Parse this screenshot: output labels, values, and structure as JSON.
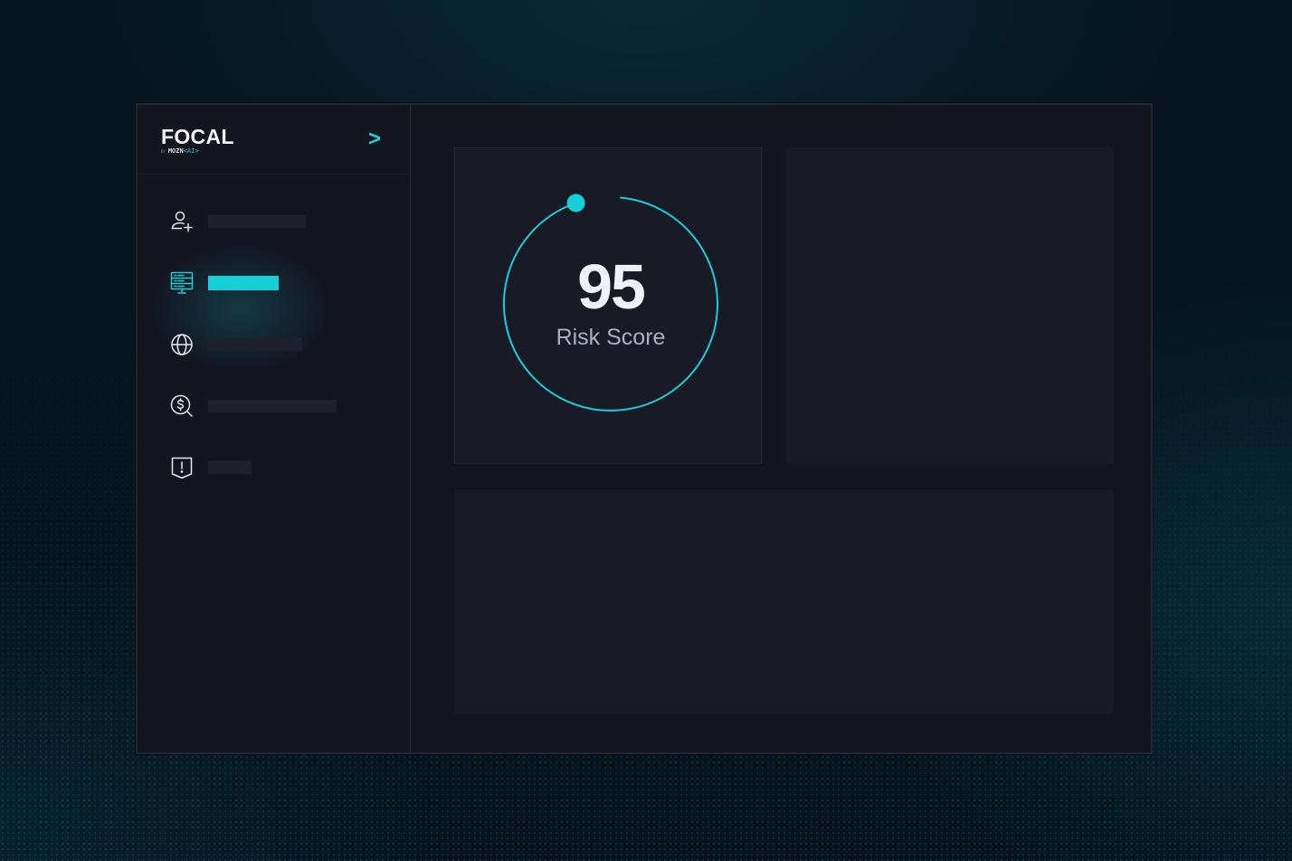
{
  "app": {
    "logo_main": "FOCAL",
    "logo_by": "BY",
    "logo_mozn": "MOZN",
    "logo_ai": "<AI>",
    "expand_symbol": ">"
  },
  "sidebar": {
    "items": [
      {
        "icon": "user-plus-icon",
        "active": false
      },
      {
        "icon": "server-monitor-icon",
        "active": true
      },
      {
        "icon": "globe-icon",
        "active": false
      },
      {
        "icon": "dollar-search-icon",
        "active": false
      },
      {
        "icon": "alert-shield-icon",
        "active": false
      }
    ]
  },
  "risk_card": {
    "score": "95",
    "label": "Risk Score",
    "gauge_fraction": 0.95
  },
  "colors": {
    "accent": "#16cfd9",
    "background": "#07141d",
    "panel": "#13151f",
    "card": "#181b26",
    "placeholder": "#1c212c"
  }
}
